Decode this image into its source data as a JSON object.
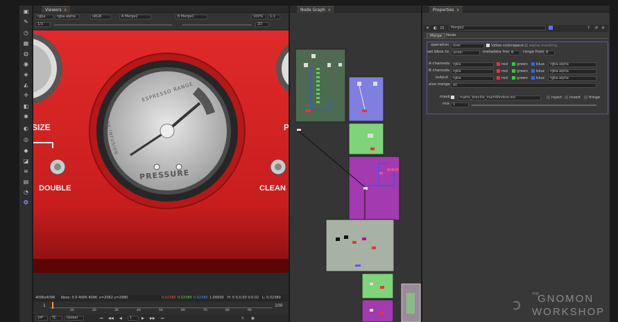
{
  "viewer": {
    "tab_label": "Viewers",
    "toolbar": {
      "channels": "rgba",
      "alpha": "rgba.alpha",
      "colorspace": "sRGB",
      "a_input": "A  Merge2",
      "b_input": "B  Merge1",
      "zoom": "100%",
      "ratio": "1:1",
      "mode": "2D",
      "frame_step": "1/3"
    },
    "image_text": {
      "size_label": "SIZE",
      "double_label": "DOUBLE",
      "clean_label": "CLEAN",
      "right_p": "P",
      "gauge_top": "ESPRESSO RANGE",
      "gauge_left": "PRE-INFUSION",
      "gauge_bottom": "PRESSURE"
    },
    "status": {
      "format": "4096x4096",
      "bbox": "bbox: 0 0 4096 4096",
      "coords": "x=2062 y=2980",
      "r": "0.02380",
      "g": "0.02380",
      "b": "0.02380",
      "a": "1.00000",
      "hsv": "H: 0 S:0.00 V:0.02",
      "l": "L: 0.02380"
    },
    "timeline": {
      "start": "1",
      "end": "100",
      "fps": "24*",
      "tc": "TC",
      "global": "Global",
      "current_frame": "1",
      "ticks": [
        "10",
        "20",
        "30",
        "40",
        "50",
        "60",
        "70",
        "80",
        "90"
      ]
    }
  },
  "node_graph": {
    "tab_label": "Node Graph"
  },
  "properties": {
    "tab_label": "Properties",
    "node_name": "Merge2",
    "tabs": [
      "Merge",
      "Node"
    ],
    "rows": {
      "operation_label": "operation",
      "operation_value": "over",
      "video_colorspace": "Video colorspace",
      "alpha_masking": "alpha masking",
      "bbox_label": "set bbox to",
      "bbox_value": "union",
      "metadata_label": "metadata from",
      "metadata_value": "B",
      "range_label": "range from",
      "range_value": "B",
      "a_channels_label": "A channels",
      "a_channels_value": "rgba",
      "b_channels_label": "B channels",
      "b_channels_value": "rgba",
      "output_label": "output",
      "output_value": "rgba",
      "also_merge_label": "also merge",
      "also_merge_value": "all",
      "red": "red",
      "green": "green",
      "blue": "blue",
      "alpha_value": "rgba.alpha",
      "mask_label": "mask",
      "mask_value": "matte_breville_mainWindow.red",
      "inject": "inject",
      "invert": "invert",
      "fringe": "fringe",
      "mix_label": "mix",
      "mix_value": "1"
    }
  },
  "watermark": {
    "line1": "THE",
    "line2": "GNOMON",
    "line3": "WORKSHOP"
  },
  "colors": {
    "accent_orange": "#f0a03c",
    "machine_red": "#d42a2a",
    "node_purple": "#a23ab0",
    "node_green": "#7fd37a",
    "node_blue": "#7f7fe0",
    "node_backdrop_green": "#4e6a50",
    "node_backdrop_grey": "#a8b2a4"
  }
}
